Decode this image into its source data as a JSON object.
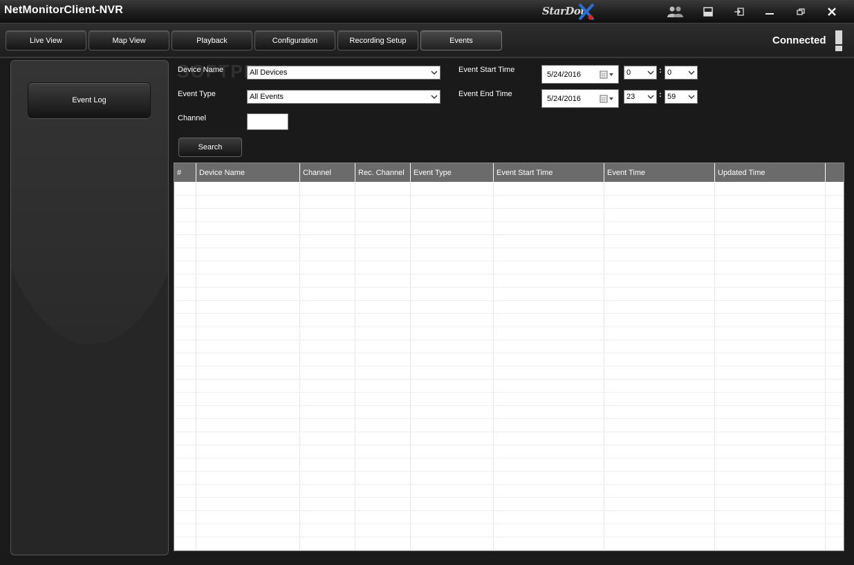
{
  "app": {
    "title": "NetMonitorClient-NVR",
    "brand": "StarDot"
  },
  "titlebar": {
    "buttons": [
      {
        "name": "users-icon"
      },
      {
        "name": "layout-icon"
      },
      {
        "name": "logout-icon"
      },
      {
        "name": "minimize-icon"
      },
      {
        "name": "restore-icon"
      },
      {
        "name": "close-icon"
      }
    ]
  },
  "nav": {
    "tabs": [
      {
        "label": "Live View"
      },
      {
        "label": "Map View"
      },
      {
        "label": "Playback"
      },
      {
        "label": "Configuration"
      },
      {
        "label": "Recording Setup"
      },
      {
        "label": "Events",
        "active": true
      }
    ],
    "status": "Connected"
  },
  "sidebar": {
    "event_log_label": "Event Log"
  },
  "filters": {
    "device_name_label": "Device Name",
    "device_name_value": "All Devices",
    "event_type_label": "Event Type",
    "event_type_value": "All Events",
    "channel_label": "Channel",
    "channel_value": "",
    "start_label": "Event Start Time",
    "start_date": "5/24/2016",
    "start_hour": "0",
    "start_minute": "0",
    "end_label": "Event End Time",
    "end_date": "5/24/2016",
    "end_hour": "23",
    "end_minute": "59",
    "search_label": "Search",
    "watermark": "SOFTPEDIA"
  },
  "table": {
    "columns": [
      "#",
      "Device Name",
      "Channel",
      "Rec. Channel",
      "Event Type",
      "Event Start Time",
      "Event Time",
      "Updated Time",
      ""
    ],
    "rows": []
  },
  "colors": {
    "header_bg": "#6b6b6b",
    "panel_bg": "#262626",
    "accent_blue": "#2a6fd6",
    "accent_red": "#d22"
  }
}
